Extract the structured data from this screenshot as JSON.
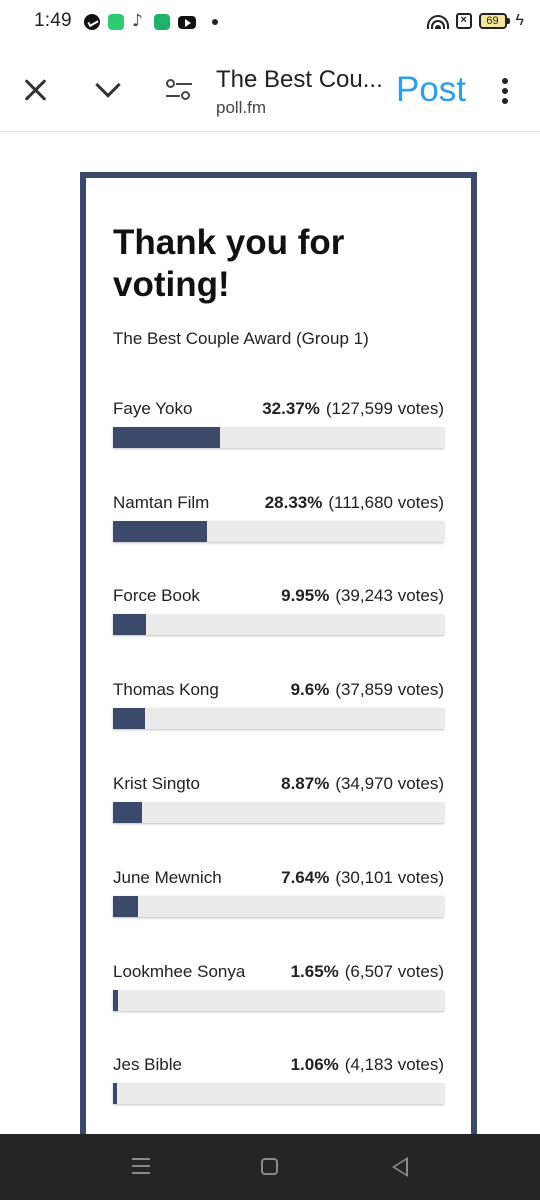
{
  "status_bar": {
    "time": "1:49",
    "battery_level": "69",
    "app_icons": [
      "messenger-icon",
      "green-app-icon",
      "tiktok-icon",
      "green-app-icon",
      "youtube-icon"
    ]
  },
  "app_bar": {
    "title": "The Best Couple Award (Group 1) - poll.fm",
    "title_display": "The Best Cou...",
    "domain": "poll.fm",
    "post_label": "Post",
    "post_color": "#2e9ee8"
  },
  "poll": {
    "heading": "Thank you for voting!",
    "name": "The Best Couple Award (Group 1)",
    "accent_color": "#3b4a6b",
    "options": [
      {
        "name": "Faye Yoko",
        "percent_label": "32.37%",
        "votes_label": "(127,599 votes)",
        "percent": 32.37
      },
      {
        "name": "Namtan Film",
        "percent_label": "28.33%",
        "votes_label": "(111,680 votes)",
        "percent": 28.33
      },
      {
        "name": "Force Book",
        "percent_label": "9.95%",
        "votes_label": "(39,243 votes)",
        "percent": 9.95
      },
      {
        "name": "Thomas Kong",
        "percent_label": "9.6%",
        "votes_label": "(37,859 votes)",
        "percent": 9.6
      },
      {
        "name": "Krist Singto",
        "percent_label": "8.87%",
        "votes_label": "(34,970 votes)",
        "percent": 8.87
      },
      {
        "name": "June Mewnich",
        "percent_label": "7.64%",
        "votes_label": "(30,101 votes)",
        "percent": 7.64
      },
      {
        "name": "Lookmhee Sonya",
        "percent_label": "1.65%",
        "votes_label": "(6,507 votes)",
        "percent": 1.65
      },
      {
        "name": "Jes Bible",
        "percent_label": "1.06%",
        "votes_label": "(4,183 votes)",
        "percent": 1.06
      }
    ]
  }
}
